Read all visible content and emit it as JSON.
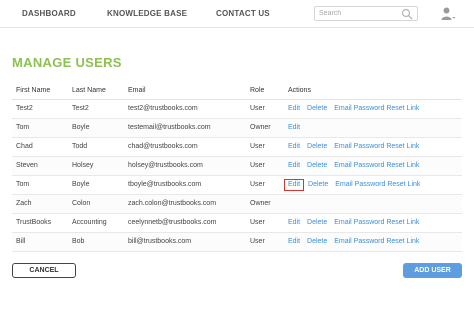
{
  "nav": {
    "dashboard": "DASHBOARD",
    "knowledge_base": "KNOWLEDGE BASE",
    "contact_us": "CONTACT US"
  },
  "search": {
    "placeholder": "Search",
    "icon": "search-icon"
  },
  "user_menu": {
    "icon": "user-icon"
  },
  "page": {
    "title": "MANAGE USERS"
  },
  "table": {
    "columns": [
      "First Name",
      "Last Name",
      "Email",
      "Role",
      "Actions"
    ],
    "rows": [
      {
        "first": "Test2",
        "last": "Test2",
        "email": "test2@trustbooks.com",
        "role": "User",
        "edit": "Edit",
        "delete": "Delete",
        "reset": "Email Password Reset Link"
      },
      {
        "first": "Tom",
        "last": "Boyle",
        "email": "testemail@trustbooks.com",
        "role": "Owner",
        "edit": "Edit"
      },
      {
        "first": "Chad",
        "last": "Todd",
        "email": "chad@trustbooks.com",
        "role": "User",
        "edit": "Edit",
        "delete": "Delete",
        "reset": "Email Password Reset Link"
      },
      {
        "first": "Steven",
        "last": "Holsey",
        "email": "holsey@trustbooks.com",
        "role": "User",
        "edit": "Edit",
        "delete": "Delete",
        "reset": "Email Password Reset Link"
      },
      {
        "first": "Tom",
        "last": "Boyle",
        "email": "tboyle@trustbooks.com",
        "role": "User",
        "edit": "Edit",
        "delete": "Delete",
        "reset": "Email Password Reset Link",
        "highlighted": true
      },
      {
        "first": "Zach",
        "last": "Colon",
        "email": "zach.colon@trustbooks.com",
        "role": "Owner"
      },
      {
        "first": "TrustBooks",
        "last": "Accounting",
        "email": "ceelynnetb@trustbooks.com",
        "role": "User",
        "edit": "Edit",
        "delete": "Delete",
        "reset": "Email Password Reset Link"
      },
      {
        "first": "Bill",
        "last": "Bob",
        "email": "bill@trustbooks.com",
        "role": "User",
        "edit": "Edit",
        "delete": "Delete",
        "reset": "Email Password Reset Link"
      }
    ]
  },
  "buttons": {
    "cancel": "CANCEL",
    "add_user": "ADD USER"
  },
  "colors": {
    "title": "#8cc152",
    "link": "#3a8fd9",
    "primary_button": "#5d9de0",
    "highlight_border": "#d9342b"
  }
}
